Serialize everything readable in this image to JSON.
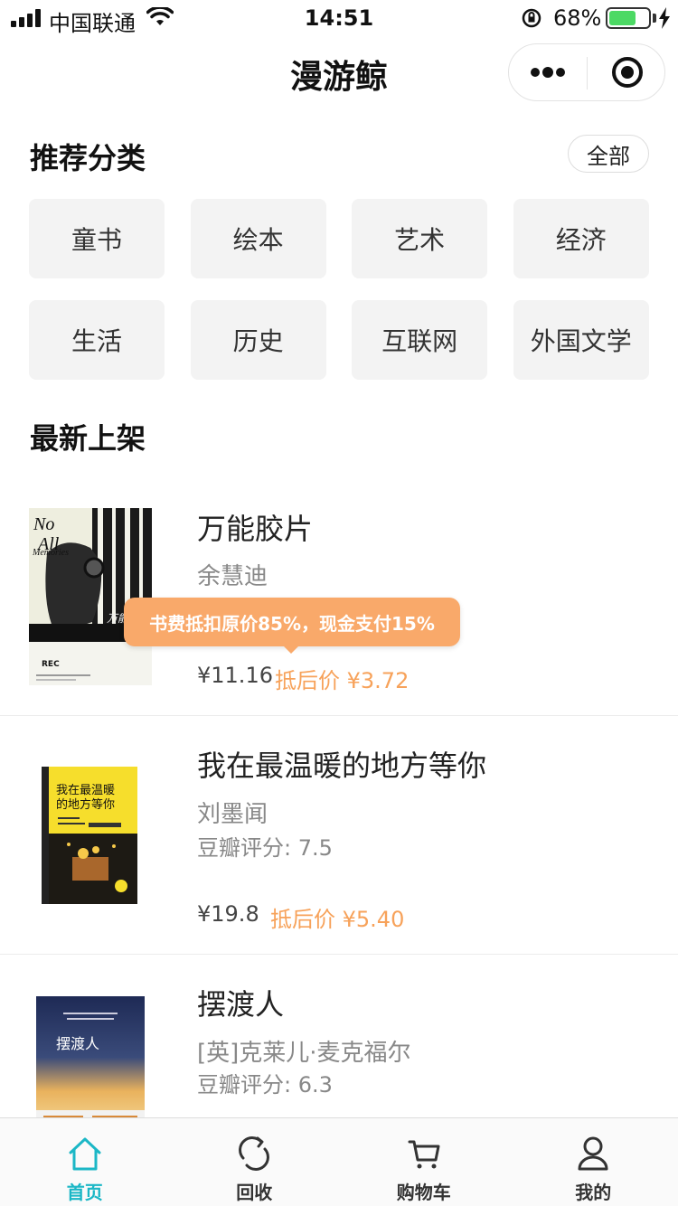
{
  "status_bar": {
    "carrier": "中国联通",
    "time": "14:51",
    "battery_percent": "68%",
    "battery_level": 0.68
  },
  "nav": {
    "title": "漫游鲸",
    "more_icon": "more-dots-icon",
    "close_icon": "target-icon"
  },
  "categories": {
    "title": "推荐分类",
    "all_label": "全部",
    "items": [
      "童书",
      "绘本",
      "艺术",
      "经济",
      "生活",
      "历史",
      "互联网",
      "外国文学"
    ]
  },
  "new_arrivals": {
    "title": "最新上架",
    "tooltip": "书费抵扣原价85%，现金支付15%",
    "books": [
      {
        "title": "万能胶片",
        "author": "余慧迪",
        "rating": "",
        "price": "¥11.16",
        "discount": "抵后价 ¥3.72",
        "cover_text_1": "No",
        "cover_text_2": "All",
        "cover_text_3": "Memories",
        "cover_text_4": "万能胶片",
        "cover_text_5": "REC"
      },
      {
        "title": "我在最温暖的地方等你",
        "author": "刘墨闻",
        "rating": "豆瓣评分: 7.5",
        "price": "¥19.8",
        "discount": "抵后价 ¥5.40",
        "cover_text_1": "我在最温暖",
        "cover_text_2": "的地方等你"
      },
      {
        "title": "摆渡人",
        "author": "[英]克莱儿·麦克福尔",
        "rating": "豆瓣评分: 6.3",
        "cover_text_1": "摆渡人"
      }
    ]
  },
  "tabbar": {
    "items": [
      {
        "label": "首页",
        "icon": "home-icon",
        "active": true
      },
      {
        "label": "回收",
        "icon": "recycle-icon",
        "active": false
      },
      {
        "label": "购物车",
        "icon": "cart-icon",
        "active": false
      },
      {
        "label": "我的",
        "icon": "user-icon",
        "active": false
      }
    ]
  },
  "colors": {
    "accent": "#1bb7c6",
    "discount": "#f7a25a",
    "tooltip_bg": "#f9a96a"
  }
}
